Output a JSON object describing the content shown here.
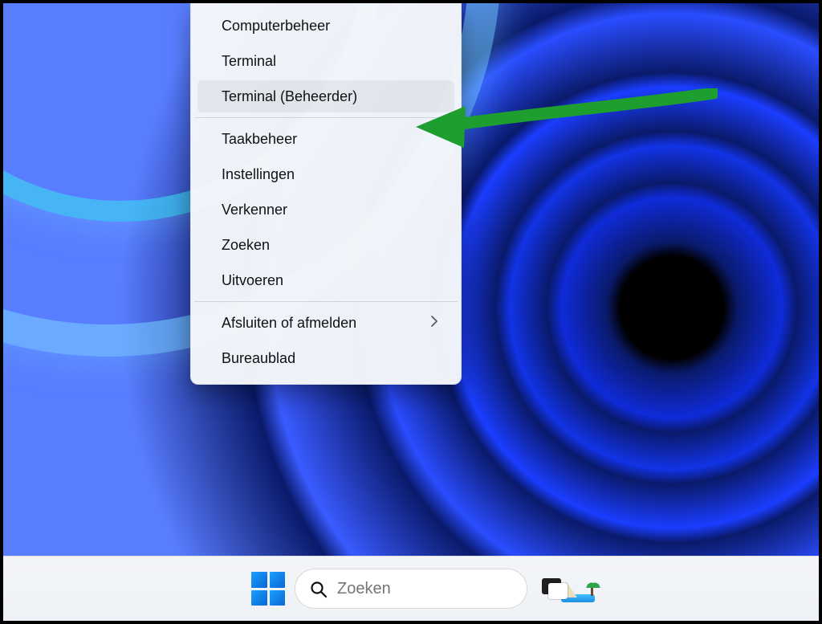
{
  "context_menu": {
    "items": [
      {
        "label": "Computerbeheer",
        "has_submenu": false
      },
      {
        "label": "Terminal",
        "has_submenu": false
      },
      {
        "label": "Terminal (Beheerder)",
        "has_submenu": false,
        "highlighted": true
      }
    ],
    "items2": [
      {
        "label": "Taakbeheer",
        "has_submenu": false
      },
      {
        "label": "Instellingen",
        "has_submenu": false
      },
      {
        "label": "Verkenner",
        "has_submenu": false
      },
      {
        "label": "Zoeken",
        "has_submenu": false
      },
      {
        "label": "Uitvoeren",
        "has_submenu": false
      }
    ],
    "items3": [
      {
        "label": "Afsluiten of afmelden",
        "has_submenu": true
      },
      {
        "label": "Bureaublad",
        "has_submenu": false
      }
    ]
  },
  "taskbar": {
    "search_placeholder": "Zoeken"
  },
  "annotation": {
    "arrow_color": "#1e9e2e"
  }
}
